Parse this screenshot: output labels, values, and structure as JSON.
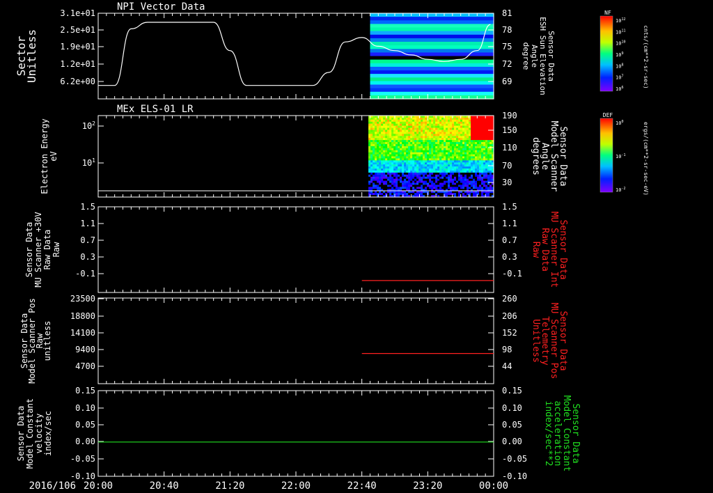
{
  "figure": {
    "date_label": "2016/106",
    "time_ticks": [
      "20:00",
      "20:40",
      "21:20",
      "22:00",
      "22:40",
      "23:20",
      "00:00"
    ]
  },
  "colors": {
    "white": "#ffffff",
    "red": "#ff2020",
    "green": "#20e020",
    "background": "#000000"
  },
  "colorbars": [
    {
      "label": "NF",
      "units": "cnts/(cm**2-sr-sec)",
      "ticks": [
        "10^12",
        "10^11",
        "10^10",
        "10^9",
        "10^8",
        "10^7",
        "10^6"
      ]
    },
    {
      "label": "DEF",
      "units": "ergs/(cm**2-sr-sec-eV)",
      "ticks": [
        "10^0",
        "10^-1",
        "10^-2"
      ]
    }
  ],
  "chart_data": [
    {
      "type": "line",
      "title": "NPI Vector Data",
      "ylabel": [
        "Sector",
        "Unitless"
      ],
      "y_ticks": [
        "3.1e+01",
        "2.5e+01",
        "1.9e+01",
        "1.2e+01",
        "6.2e+00"
      ],
      "ylabel_right": [
        "Sensor Data",
        "ESH Sun Elevation",
        "Angle",
        "degree"
      ],
      "y_ticks_right": [
        "81",
        "78",
        "75",
        "72",
        "69"
      ],
      "series_color": "white",
      "x": [
        "20:00",
        "20:10",
        "20:20",
        "20:30",
        "20:40",
        "20:50",
        "21:00",
        "21:10",
        "21:20",
        "21:30",
        "21:40",
        "21:50",
        "22:00",
        "22:10",
        "22:20",
        "22:30",
        "22:40",
        "22:50",
        "23:00",
        "23:10",
        "23:20",
        "23:30",
        "23:40",
        "23:50",
        "23:58"
      ],
      "values": [
        2,
        2,
        28,
        31,
        31,
        31,
        31,
        31,
        18,
        2,
        2,
        2,
        2,
        2,
        8,
        22,
        24,
        20,
        18,
        16,
        14,
        13,
        14,
        18,
        30
      ],
      "spectrogram": {
        "start": "22:45",
        "end": "00:00",
        "quantity": "NF"
      }
    },
    {
      "type": "heatmap",
      "title": "MEx ELS-01 LR",
      "ylabel": [
        "Electron Energy",
        "eV"
      ],
      "y_ticks": [
        "10^2",
        "10^1"
      ],
      "ylabel_right": [
        "Sensor Data",
        "Model Scanner",
        "Angle",
        "degrees"
      ],
      "y_ticks_right": [
        "190",
        "150",
        "110",
        "70",
        "30"
      ],
      "spectrogram": {
        "start": "22:44",
        "end": "00:00",
        "quantity": "DEF"
      }
    },
    {
      "type": "line",
      "ylabel": [
        "Sensor Data",
        "MU Scanner +30V",
        "Raw Data",
        "Raw"
      ],
      "y_ticks": [
        "1.5",
        "1.1",
        "0.7",
        "0.3",
        "-0.1"
      ],
      "ylim": [
        -0.3,
        1.5
      ],
      "ylabel_right": [
        "Sensor Data",
        "MU Scanner Int",
        "Raw Data",
        "Raw"
      ],
      "y_ticks_right": [
        "1.5",
        "1.1",
        "0.7",
        "0.3",
        "-0.1"
      ],
      "series_color": "red",
      "x": [
        "22:40",
        "00:00"
      ],
      "values": [
        -0.05,
        -0.05
      ]
    },
    {
      "type": "line",
      "ylabel": [
        "Sensor Data",
        "Model Scanner Pos",
        "Raw",
        "unitless"
      ],
      "y_ticks": [
        "23500",
        "18800",
        "14100",
        "9400",
        "4700"
      ],
      "ylim": [
        0,
        23500
      ],
      "ylabel_right": [
        "Sensor Data",
        "MU Scanner Pos",
        "Telemetry",
        "Unitless"
      ],
      "y_ticks_right": [
        "260",
        "206",
        "152",
        "98",
        "44"
      ],
      "series_color": "red",
      "x": [
        "22:40",
        "00:00"
      ],
      "values": [
        8300,
        8300
      ]
    },
    {
      "type": "line",
      "ylabel": [
        "Sensor Data",
        "Model Constant",
        "velocity",
        "index/sec"
      ],
      "y_ticks": [
        "0.15",
        "0.10",
        "0.05",
        "0.00",
        "-0.05",
        "-0.10"
      ],
      "ylim": [
        -0.1,
        0.15
      ],
      "ylabel_right": [
        "Sensor Data",
        "Model Constant",
        "acceleration",
        "index/sec**2"
      ],
      "y_ticks_right": [
        "0.15",
        "0.10",
        "0.05",
        "0.00",
        "-0.05",
        "-0.10"
      ],
      "series_color": "green",
      "x": [
        "20:00",
        "00:00"
      ],
      "values": [
        0.0,
        0.0
      ]
    }
  ]
}
